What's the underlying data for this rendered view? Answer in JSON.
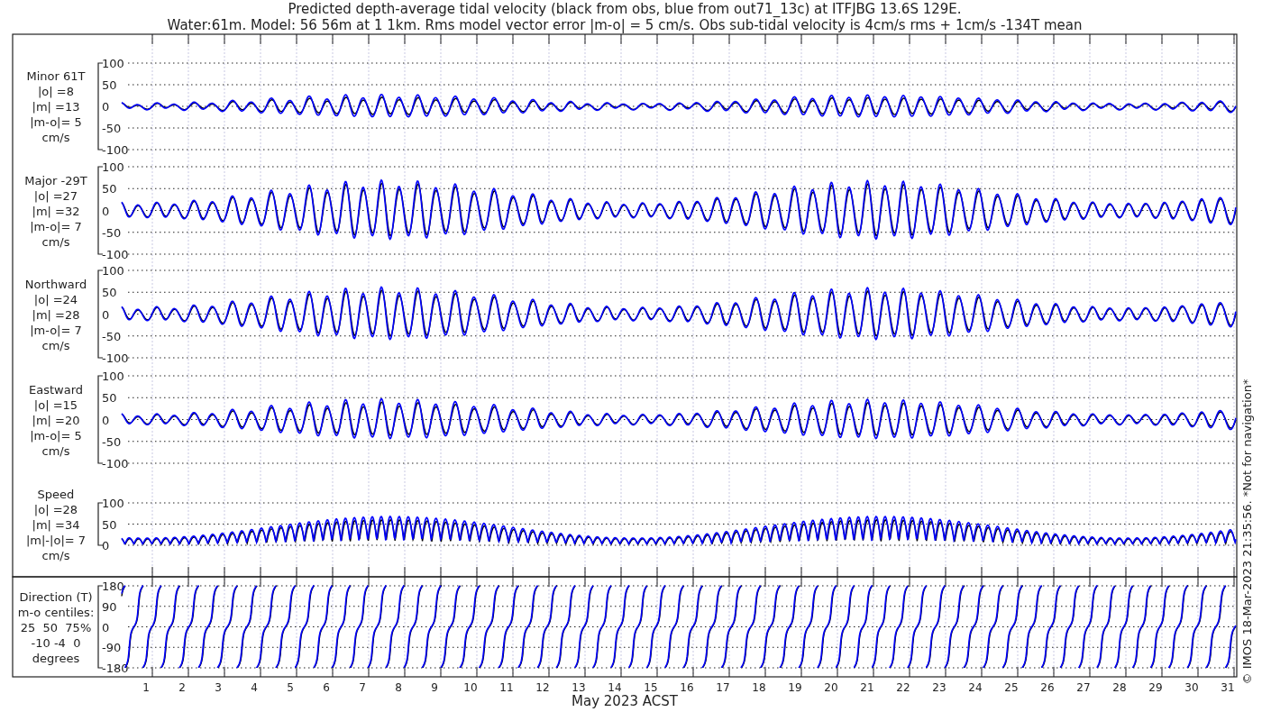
{
  "title": [
    "Predicted depth-average tidal velocity (black from obs, blue from out71_13c) at ITFJBG 13.6S 129E.",
    "Water:61m. Model: 56 56m at 1 1km. Rms model vector error |m-o| = 5 cm/s. Obs sub-tidal velocity is 4cm/s rms + 1cm/s -134T mean"
  ],
  "panels": [
    {
      "kind": "velocity",
      "label": [
        "Minor 61T",
        "|o| =8",
        "|m| =13",
        "|m-o|= 5",
        "cm/s"
      ],
      "yticks": [
        "100",
        "50",
        "0",
        "-50",
        "-100"
      ]
    },
    {
      "kind": "velocity",
      "label": [
        "Major -29T",
        "|o| =27",
        "|m| =32",
        "|m-o|= 7",
        "cm/s"
      ],
      "yticks": [
        "100",
        "50",
        "0",
        "-50",
        "-100"
      ]
    },
    {
      "kind": "velocity",
      "label": [
        "Northward",
        "|o| =24",
        "|m| =28",
        "|m-o|= 7",
        "cm/s"
      ],
      "yticks": [
        "100",
        "50",
        "0",
        "-50",
        "-100"
      ]
    },
    {
      "kind": "velocity",
      "label": [
        "Eastward",
        "|o| =15",
        "|m| =20",
        "|m-o|= 5",
        "cm/s"
      ],
      "yticks": [
        "100",
        "50",
        "0",
        "-50",
        "-100"
      ]
    },
    {
      "kind": "speed",
      "label": [
        "Speed",
        "|o| =28",
        "|m| =34",
        "|m|-|o|= 7",
        "cm/s"
      ],
      "yticks": [
        "100",
        "50",
        "0"
      ]
    },
    {
      "kind": "direction",
      "label": [
        "Direction (T)",
        "m-o centiles:",
        "25  50  75%",
        "-10 -4  0",
        "degrees"
      ],
      "yticks": [
        "180",
        "90",
        "0",
        "-90",
        "-180"
      ]
    }
  ],
  "xticks": [
    "1",
    "2",
    "3",
    "4",
    "5",
    "6",
    "7",
    "8",
    "9",
    "10",
    "11",
    "12",
    "13",
    "14",
    "15",
    "16",
    "17",
    "18",
    "19",
    "20",
    "21",
    "22",
    "23",
    "24",
    "25",
    "26",
    "27",
    "28",
    "29",
    "30",
    "31"
  ],
  "xlabel": "May 2023 ACST",
  "credit": "© IMOS 18-Mar-2023 21:35:56. *Not for navigation*"
}
